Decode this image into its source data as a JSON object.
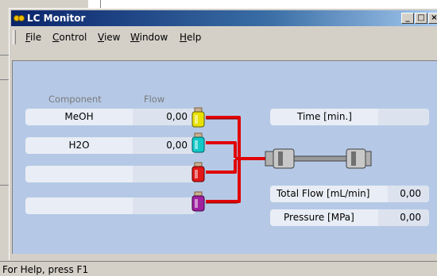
{
  "window": {
    "title": "LC Monitor"
  },
  "title_buttons": {
    "minimize": "_",
    "maximize": "□",
    "close": "×"
  },
  "menu": [
    {
      "id": "file",
      "accel": "F",
      "rest": "ile"
    },
    {
      "id": "control",
      "accel": "C",
      "rest": "ontrol"
    },
    {
      "id": "view",
      "accel": "V",
      "rest": "iew"
    },
    {
      "id": "window",
      "accel": "W",
      "rest": "indow"
    },
    {
      "id": "help",
      "accel": "H",
      "rest": "elp"
    }
  ],
  "columns": {
    "component": "Component",
    "flow": "Flow"
  },
  "components": [
    {
      "name": "MeOH",
      "flow": "0,00",
      "bottle_color": "#e8e000"
    },
    {
      "name": "H2O",
      "flow": "0,00",
      "bottle_color": "#10c8c8"
    },
    {
      "name": "",
      "flow": "",
      "bottle_color": "#e01818"
    },
    {
      "name": "",
      "flow": "",
      "bottle_color": "#a020a0"
    }
  ],
  "time": {
    "label": "Time [min.]",
    "value": ""
  },
  "total_flow": {
    "label": "Total Flow [mL/min]",
    "value": "0,00"
  },
  "pressure": {
    "label": "Pressure [MPa]",
    "value": "0,00"
  },
  "status": {
    "text": "For Help, press F1"
  },
  "colors": {
    "title_start": "#0a246a",
    "title_end": "#a6caf0",
    "panel": "#b5c9e6",
    "pipe": "#e00000"
  }
}
